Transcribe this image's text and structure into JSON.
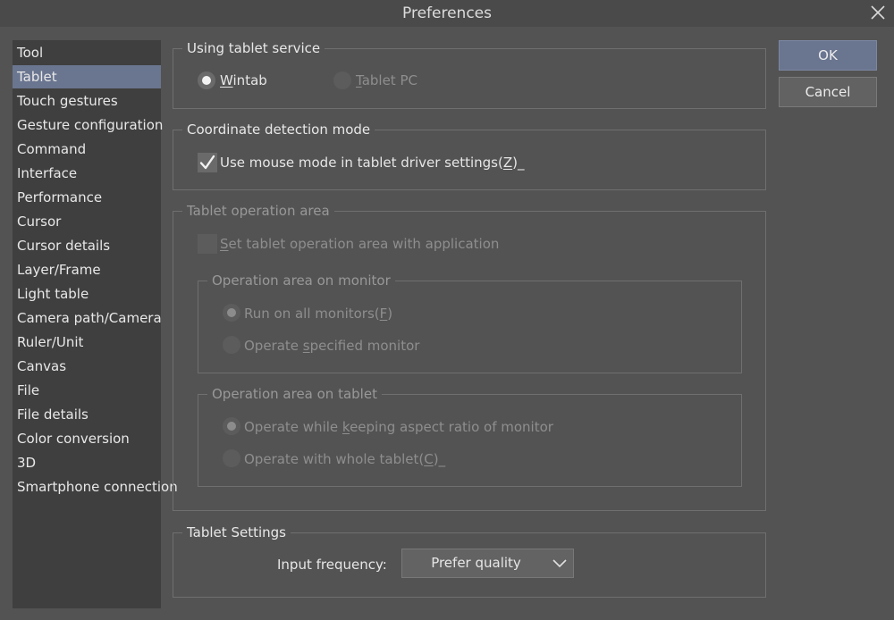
{
  "window": {
    "title": "Preferences"
  },
  "sidebar": {
    "items": [
      "Tool",
      "Tablet",
      "Touch gestures",
      "Gesture configuration",
      "Command",
      "Interface",
      "Performance",
      "Cursor",
      "Cursor details",
      "Layer/Frame",
      "Light table",
      "Camera path/Camera",
      "Ruler/Unit",
      "Canvas",
      "File",
      "File details",
      "Color conversion",
      "3D",
      "Smartphone connection"
    ],
    "selected": "Tablet"
  },
  "tablet_service": {
    "title": "Using tablet service",
    "wintab": {
      "pre": "",
      "key": "W",
      "post": "intab",
      "selected": true
    },
    "tablet_pc": {
      "pre": "",
      "key": "T",
      "post": "ablet PC",
      "selected": false
    }
  },
  "coord_mode": {
    "title": "Coordinate detection mode",
    "mouse_mode": {
      "pre": "Use mouse mode in tablet driver settings(",
      "key": "Z",
      "post": ")_",
      "checked": true
    }
  },
  "operation_area": {
    "title": "Tablet operation area",
    "set_area": {
      "pre": "",
      "key": "S",
      "post": "et tablet operation area with application",
      "checked": false
    },
    "monitor": {
      "title": "Operation area on monitor",
      "all": {
        "pre": "Run on all monitors(",
        "key": "F",
        "post": ")",
        "selected": true
      },
      "specified": {
        "pre": "Operate ",
        "key": "s",
        "post": "pecified monitor",
        "selected": false
      }
    },
    "tablet": {
      "title": "Operation area on tablet",
      "aspect": {
        "pre": "Operate while ",
        "key": "k",
        "post": "eeping aspect ratio of monitor",
        "selected": true
      },
      "whole": {
        "pre": "Operate with whole tablet(",
        "key": "C",
        "post": ")_",
        "selected": false
      }
    }
  },
  "tablet_settings": {
    "title": "Tablet Settings",
    "input_frequency_label": "Input frequency:",
    "input_frequency_value": "Prefer quality"
  },
  "buttons": {
    "ok": "OK",
    "cancel": "Cancel"
  },
  "colors": {
    "accent": "#6a7590",
    "background": "#535353",
    "sidebar": "#3f3f3f"
  },
  "icons": {
    "close": "close-icon",
    "check": "check-icon",
    "dropdown": "chevron-down-icon"
  }
}
